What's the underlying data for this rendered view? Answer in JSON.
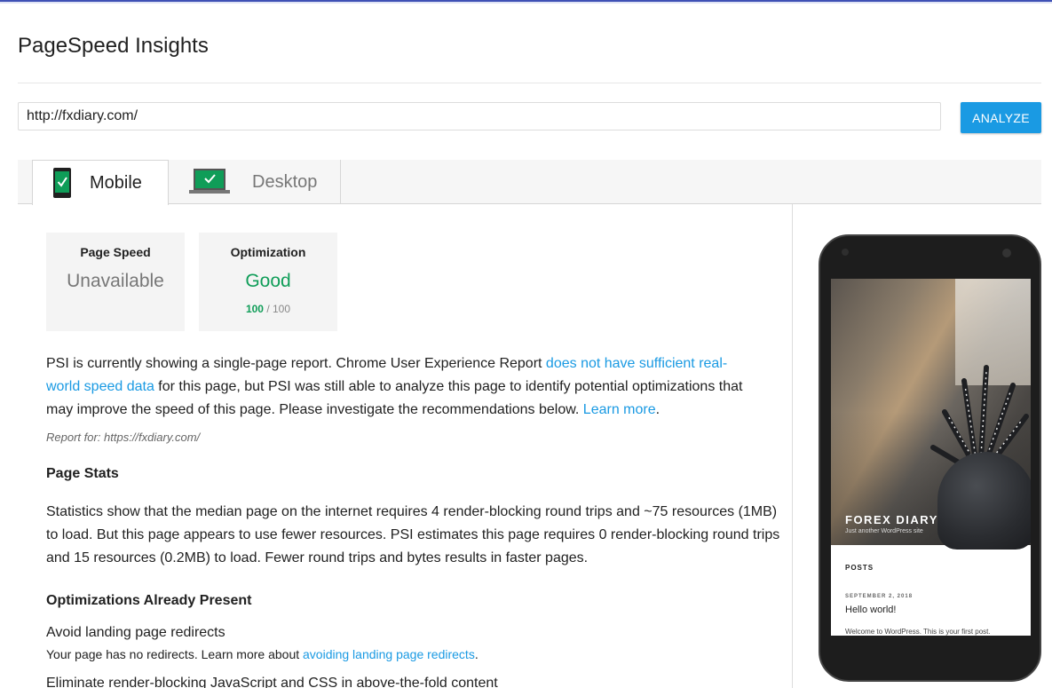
{
  "app": {
    "title": "PageSpeed Insights"
  },
  "colors": {
    "accent": "#1a9ae3",
    "good": "#0f9d58",
    "top_bar": "#3f51b5"
  },
  "search": {
    "url_value": "http://fxdiary.com/",
    "analyze_label": "ANALYZE"
  },
  "tabs": [
    {
      "label": "Mobile",
      "icon": "smartphone-check-icon",
      "selected": true
    },
    {
      "label": "Desktop",
      "icon": "laptop-check-icon",
      "selected": false
    }
  ],
  "cards": {
    "speed": {
      "heading": "Page Speed",
      "value": "Unavailable"
    },
    "optimization": {
      "heading": "Optimization",
      "value": "Good",
      "score": "100",
      "score_max": "/ 100"
    }
  },
  "intro": {
    "part1": "PSI is currently showing a single-page report. Chrome User Experience Report ",
    "link1": "does not have sufficient real-world speed data",
    "part2": " for this page, but PSI was still able to analyze this page to identify potential optimizations that may improve the speed of this page. Please investigate the recommendations below. ",
    "link2": "Learn more",
    "part3": "."
  },
  "report_for": "Report for: https://fxdiary.com/",
  "page_stats": {
    "heading": "Page Stats",
    "text": "Statistics show that the median page on the internet requires 4 render-blocking round trips and ~75 resources (1MB) to load. But this page appears to use fewer resources. PSI estimates this page requires 0 render-blocking round trips and 15 resources (0.2MB) to load. Fewer round trips and bytes results in faster pages."
  },
  "optimizations": {
    "heading": "Optimizations Already Present",
    "items": [
      {
        "title": "Avoid landing page redirects",
        "desc_prefix": "Your page has no redirects. Learn more about ",
        "desc_link": "avoiding landing page redirects",
        "desc_suffix": "."
      },
      {
        "title": "Eliminate render-blocking JavaScript and CSS in above-the-fold content"
      }
    ]
  },
  "preview": {
    "site_title": "FOREX DIARY",
    "tagline": "Just another WordPress site",
    "posts_label": "POSTS",
    "post_date": "SEPTEMBER 2, 2018",
    "post_title": "Hello world!",
    "post_excerpt": "Welcome to WordPress. This is your first post."
  }
}
